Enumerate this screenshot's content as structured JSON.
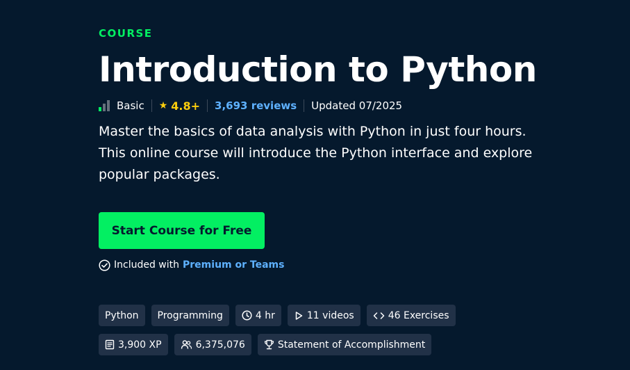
{
  "eyebrow": "COURSE",
  "title": "Introduction to Python",
  "meta": {
    "level": "Basic",
    "rating": "4.8+",
    "reviews": "3,693 reviews",
    "updated": "Updated 07/2025"
  },
  "description": "Master the basics of data analysis with Python in just four hours. This online course will introduce the Python interface and explore popular packages.",
  "cta_label": "Start Course for Free",
  "included": {
    "prefix": "Included with",
    "link": "Premium or Teams"
  },
  "tags_row1": {
    "python": "Python",
    "programming": "Programming",
    "duration": "4 hr",
    "videos": "11 videos",
    "exercises": "46 Exercises"
  },
  "tags_row2": {
    "xp": "3,900 XP",
    "learners": "6,375,076",
    "certificate": "Statement of Accomplishment"
  },
  "colors": {
    "background": "#05192d",
    "accent_green": "#03ef62",
    "link_blue": "#5eb1ff",
    "star_yellow": "#fcce0d",
    "tag_bg": "#213147"
  },
  "icons": {
    "level": "level-bars-icon",
    "rating": "star-icon",
    "included": "check-circle-icon",
    "duration": "clock-icon",
    "videos": "play-icon",
    "exercises": "code-icon",
    "xp": "document-icon",
    "learners": "users-icon",
    "certificate": "trophy-icon"
  }
}
